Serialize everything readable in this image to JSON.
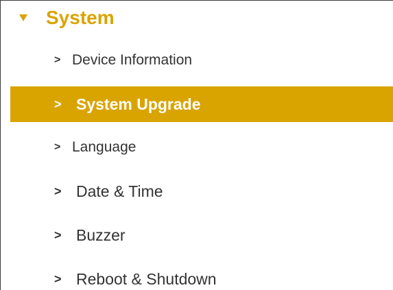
{
  "colors": {
    "accent": "#d9a400",
    "selected_bg": "#d9a400",
    "selected_text": "#ffffff",
    "text": "#333333"
  },
  "header": {
    "title": "System",
    "icon": "triangle-down-icon"
  },
  "menu": {
    "chevron": ">",
    "items": [
      {
        "label": "Device Information"
      },
      {
        "label": "System Upgrade",
        "selected": true
      },
      {
        "label": "Language"
      },
      {
        "label": "Date & Time"
      },
      {
        "label": "Buzzer"
      },
      {
        "label": "Reboot & Shutdown"
      }
    ]
  }
}
